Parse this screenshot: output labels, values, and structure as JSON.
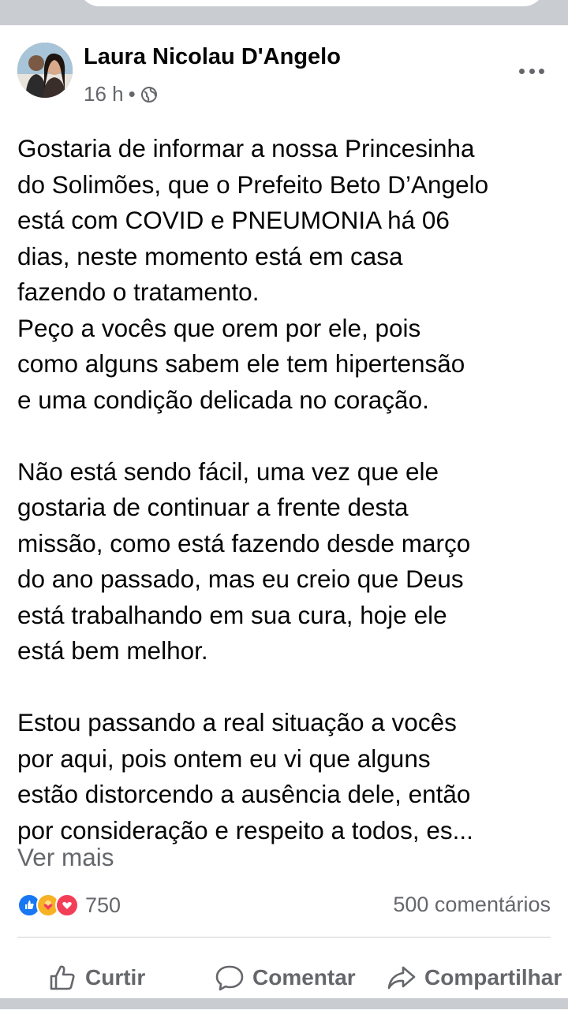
{
  "post": {
    "author": "Laura Nicolau D'Angelo",
    "time": "16 h",
    "separator": "•",
    "paragraphs": [
      "Gostaria de informar a nossa Princesinha\ndo Solimões, que o Prefeito Beto D’Angelo\nestá com COVID e PNEUMONIA há 06\ndias, neste momento está em casa\nfazendo o tratamento.\nPeço a vocês que orem por ele, pois\ncomo alguns sabem ele tem hipertensão\ne uma condição delicada no coração.",
      "Não está sendo fácil, uma vez que ele\ngostaria de continuar a frente desta\nmissão, como está fazendo desde março\ndo ano passado, mas eu creio que Deus\nestá trabalhando em sua cura, hoje ele\nestá bem melhor.",
      "Estou passando a real situação a vocês\npor aqui, pois ontem eu vi que alguns\nestão distorcendo a ausência dele, então\npor consideração e respeito a todos, es..."
    ],
    "see_more": "Ver mais",
    "reaction_count": "750",
    "comment_count": "500 comentários"
  },
  "actions": {
    "like": "Curtir",
    "comment": "Comentar",
    "share": "Compartilhar"
  },
  "icons": {
    "privacy": "globe-icon",
    "options": "more-options-icon",
    "like": "thumbs-up-icon",
    "comment": "comment-bubble-icon",
    "share": "share-arrow-icon"
  },
  "colors": {
    "like_blue": "#1877f2",
    "care_yellow": "#f7b125",
    "love_red": "#f33e58",
    "secondary_text": "#65676b",
    "separator_gray": "#c9ccd1"
  }
}
